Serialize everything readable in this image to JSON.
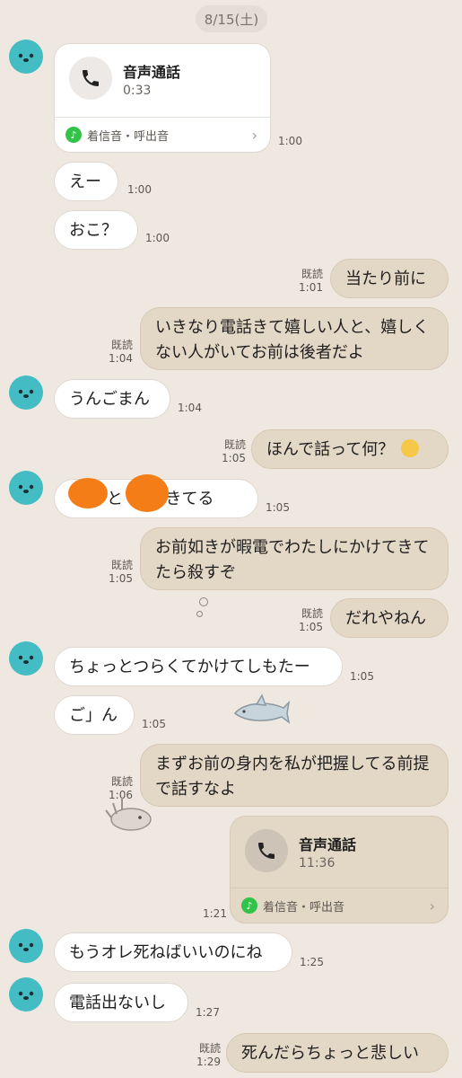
{
  "date": "8/15(土)",
  "read_label": "既読",
  "calls": [
    {
      "title": "音声通話",
      "duration": "0:33",
      "ringtone": "着信音・呼出音",
      "time": "1:00"
    },
    {
      "title": "音声通話",
      "duration": "11:36",
      "ringtone": "着信音・呼出音",
      "time": "1:21"
    }
  ],
  "messages": [
    {
      "text": "えー",
      "time": "1:00"
    },
    {
      "text": "おこ？",
      "time": "1:00"
    },
    {
      "text": "当たり前に",
      "time": "1:01"
    },
    {
      "text": "いきなり電話きて嬉しい人と、嬉しくない人がいてお前は後者だよ",
      "time": "1:04"
    },
    {
      "text": "うんごまん",
      "time": "1:04"
    },
    {
      "text": "ほんで話って何？",
      "time": "1:05"
    },
    {
      "text": "と 　 できてる",
      "time": "1:05"
    },
    {
      "text": "お前如きが暇電でわたしにかけてきてたら殺すぞ",
      "time": "1:05"
    },
    {
      "text": "だれやねん",
      "time": "1:05"
    },
    {
      "text": "ちょっとつらくてかけてしもたー",
      "time": "1:05"
    },
    {
      "text": "ご」ん",
      "time": "1:05"
    },
    {
      "text": "まずお前の身内を私が把握してる前提で話すなよ",
      "time": "1:06"
    },
    {
      "text": "もうオレ死ねばいいのにね",
      "time": "1:25"
    },
    {
      "text": "電話出ないし",
      "time": "1:27"
    },
    {
      "text": "死んだらちょっと悲しい",
      "time": "1:29"
    }
  ]
}
